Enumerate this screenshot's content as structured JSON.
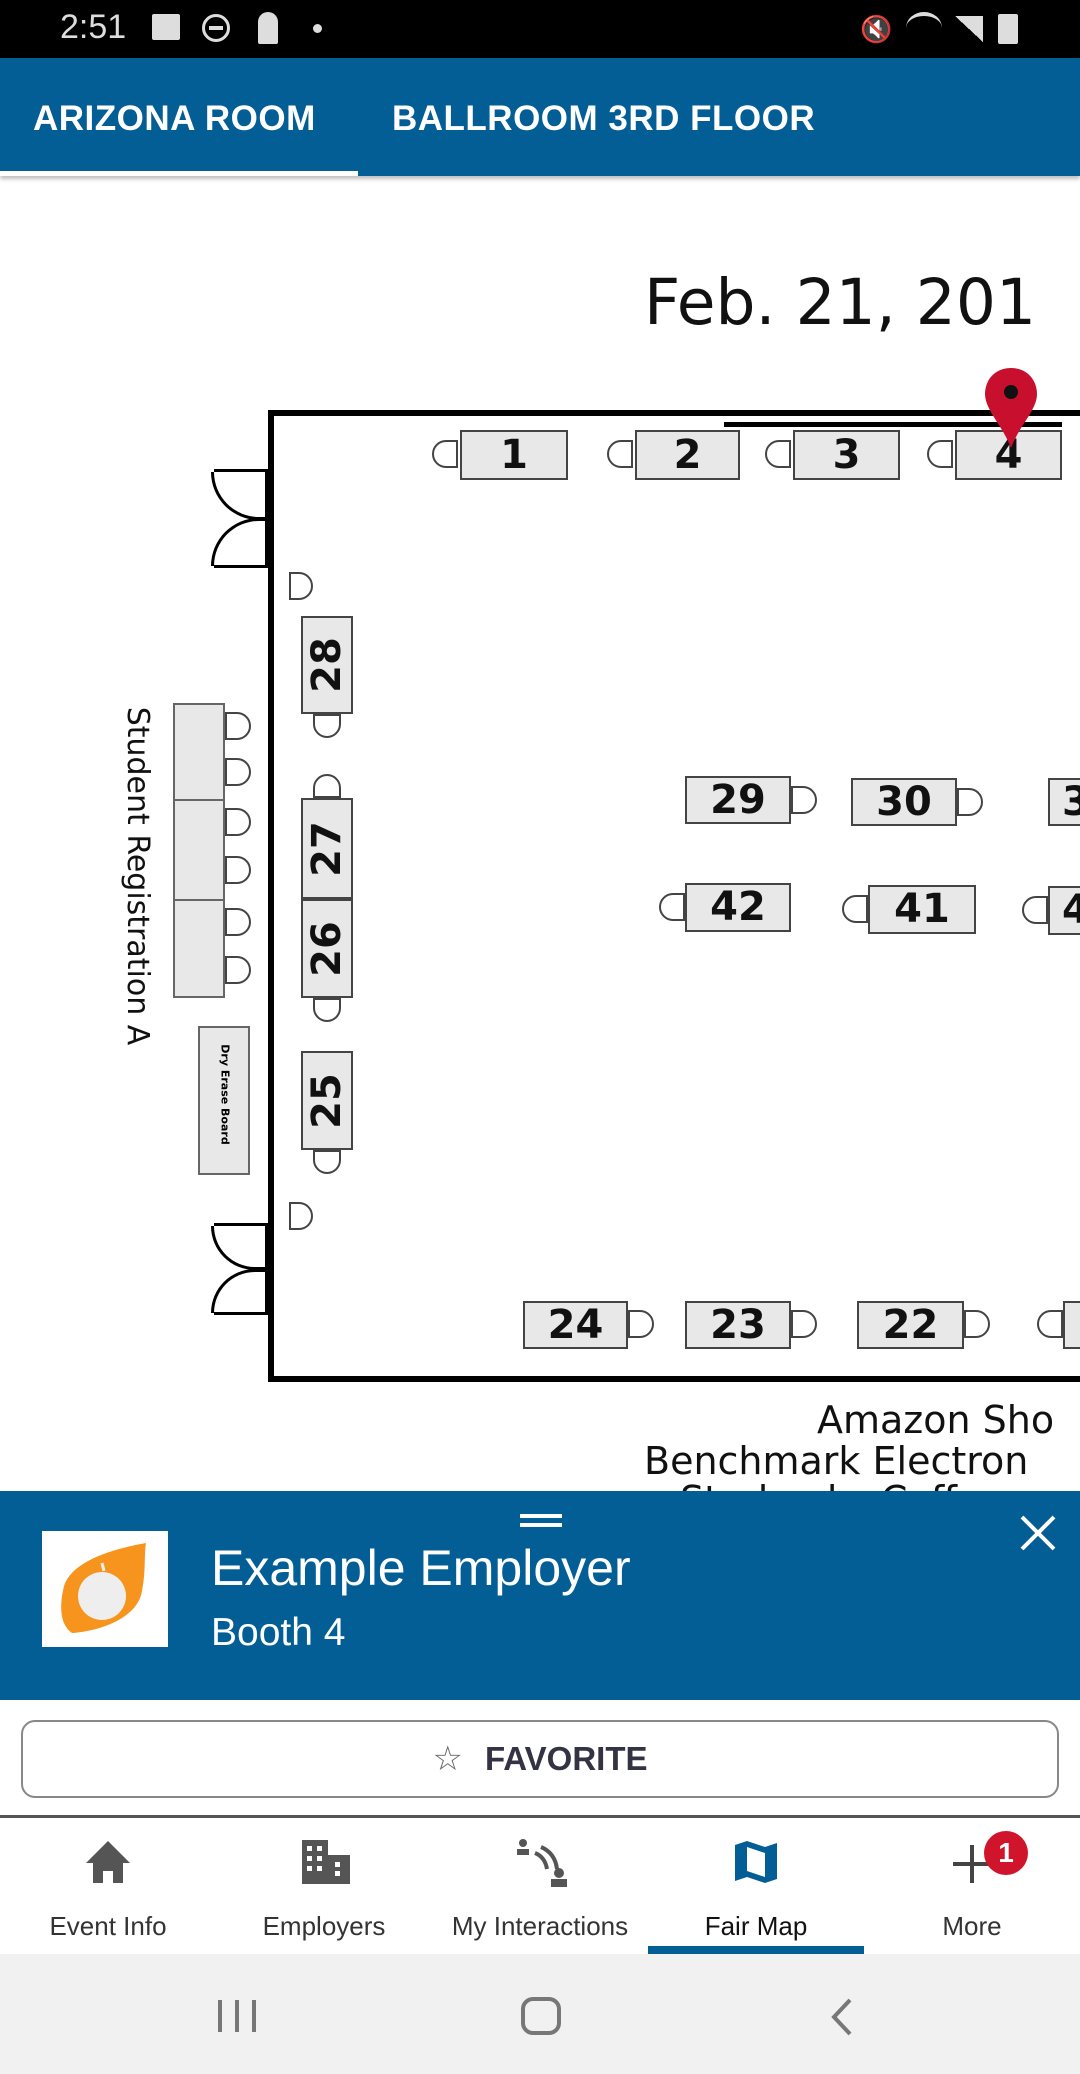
{
  "status_bar": {
    "time": "2:51",
    "icons_left": [
      "image-icon",
      "do-not-disturb-icon",
      "keyhole-icon",
      "dot-icon"
    ],
    "icons_right": [
      "mute-icon",
      "wifi-icon",
      "signal-icon",
      "battery-icon"
    ]
  },
  "tabs": [
    {
      "label": "ARIZONA ROOM",
      "active": true
    },
    {
      "label": "BALLROOM 3RD FLOOR",
      "active": false
    }
  ],
  "map": {
    "title": "Feb. 21, 201",
    "top_booths": [
      "1",
      "2",
      "3",
      "4"
    ],
    "left_booths": [
      "28",
      "27",
      "26",
      "25"
    ],
    "middle_row1": [
      "29",
      "30",
      "3"
    ],
    "middle_row2": [
      "42",
      "41",
      "4"
    ],
    "bottom_booths": [
      "24",
      "23",
      "22"
    ],
    "registration_label": "Student Registration A",
    "board_label": "Dry Erase Board",
    "bottom_labels": [
      "Amazon Sho",
      "Benchmark Electron",
      "Starbucks Coff"
    ],
    "selected_booth": "4",
    "pin_color": "#c8102e"
  },
  "sheet": {
    "employer_name": "Example Employer",
    "booth": "Booth 4",
    "logo_color": "#f7941d",
    "favorite_label": "FAVORITE"
  },
  "bottom_nav": [
    {
      "label": "Event Info",
      "icon": "home-icon"
    },
    {
      "label": "Employers",
      "icon": "building-icon"
    },
    {
      "label": "My Interactions",
      "icon": "interactions-icon"
    },
    {
      "label": "Fair Map",
      "icon": "map-icon",
      "active": true
    },
    {
      "label": "More",
      "icon": "plus-icon",
      "badge": "1"
    }
  ],
  "colors": {
    "primary": "#045e96",
    "badge": "#d0142c"
  }
}
